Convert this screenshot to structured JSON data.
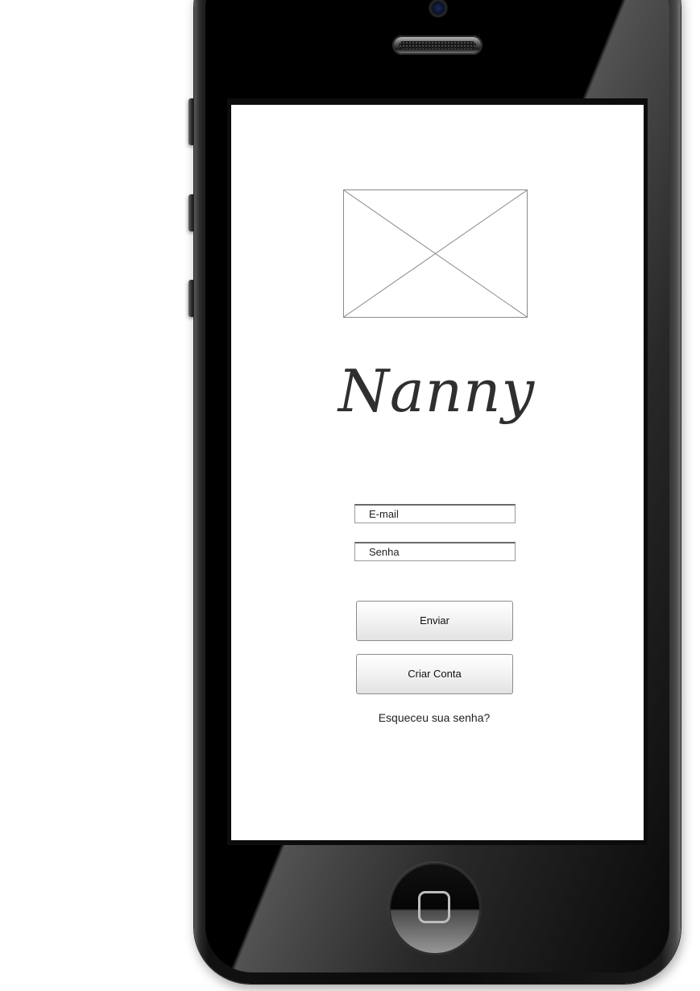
{
  "device": {
    "type": "iPhone mockup"
  },
  "screen": {
    "image_placeholder": "image-placeholder",
    "logo_text": "Nanny",
    "email_field": {
      "placeholder": "E-mail",
      "value": ""
    },
    "password_field": {
      "placeholder": "Senha",
      "value": ""
    },
    "submit_button": "Enviar",
    "create_account_button": "Criar Conta",
    "forgot_password_link": "Esqueceu sua senha?"
  },
  "colors": {
    "screen_background": "#ffffff",
    "phone_body": "#0a0a0a",
    "text": "#222222",
    "logo": "#2f2f2f",
    "button_border": "#8c8c8c"
  },
  "icons": {
    "home_button": "home-square-icon",
    "camera": "camera-icon",
    "speaker": "speaker-icon"
  }
}
